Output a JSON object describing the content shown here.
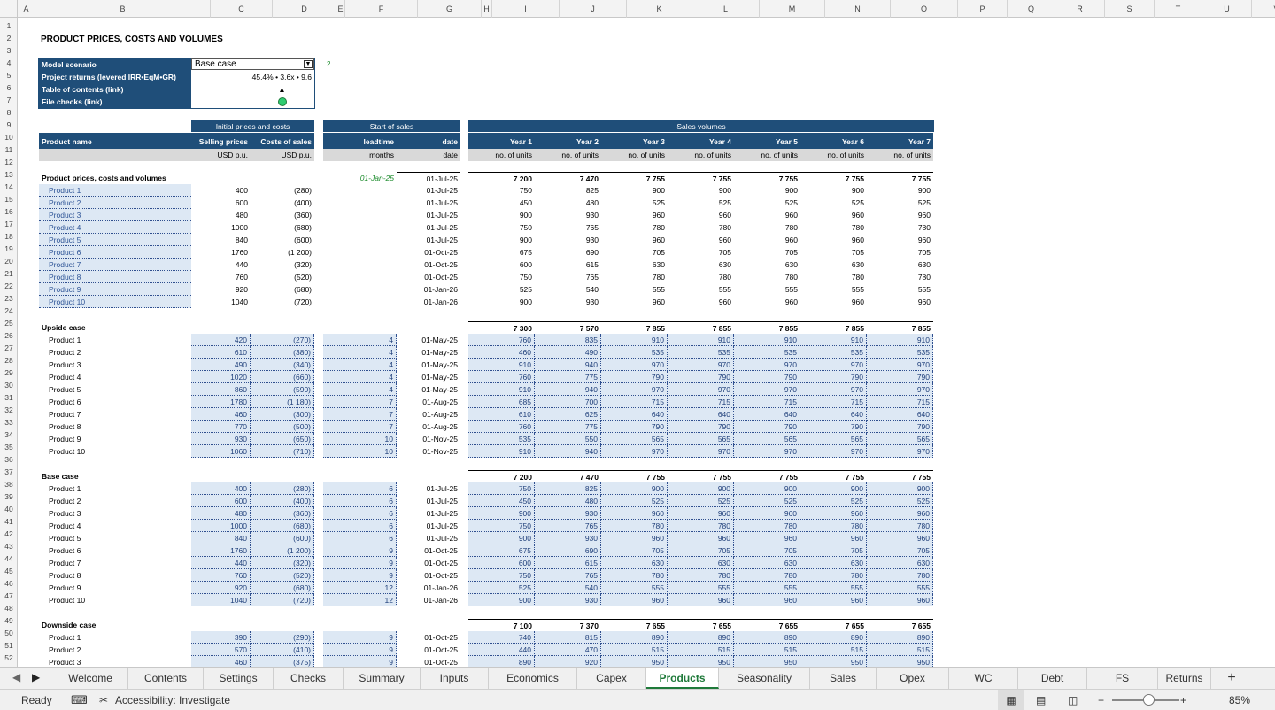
{
  "columns": [
    "A",
    "B",
    "C",
    "D",
    "E",
    "F",
    "G",
    "H",
    "I",
    "J",
    "K",
    "L",
    "M",
    "N",
    "O",
    "P",
    "Q",
    "R",
    "S",
    "T",
    "U",
    "V"
  ],
  "title": "PRODUCT PRICES, COSTS AND VOLUMES",
  "info": {
    "scenario_label": "Model scenario",
    "scenario_value": "Base case",
    "scenario_index": "2",
    "returns_label": "Project returns (levered IRR•EqM•GR)",
    "returns_value": "45.4% • 3.6x • 9.6",
    "toc_label": "Table of contents (link)",
    "toc_symbol": "▲",
    "checks_label": "File checks (link)"
  },
  "headers": {
    "group_prices": "Initial prices and costs",
    "group_start": "Start of sales",
    "group_volumes": "Sales volumes",
    "product_name": "Product name",
    "selling_prices": "Selling prices",
    "costs_of_sales": "Costs of sales",
    "leadtime": "leadtime",
    "date": "date",
    "years": [
      "Year 1",
      "Year 2",
      "Year 3",
      "Year 4",
      "Year 5",
      "Year 6",
      "Year 7"
    ],
    "unit_price": "USD p.u.",
    "unit_cost": "USD p.u.",
    "unit_months": "months",
    "unit_date": "date",
    "unit_units": "no. of units"
  },
  "sections": [
    {
      "title": "Product prices, costs and volumes",
      "startdate": "01-Jan-25",
      "totaldate": "01-Jul-25",
      "totals": [
        "7 200",
        "7 470",
        "7 755",
        "7 755",
        "7 755",
        "7 755",
        "7 755"
      ],
      "rows": [
        {
          "name": "Product 1",
          "price": "400",
          "cost": "(280)",
          "lead": "",
          "date": "01-Jul-25",
          "vols": [
            "750",
            "825",
            "900",
            "900",
            "900",
            "900",
            "900"
          ]
        },
        {
          "name": "Product 2",
          "price": "600",
          "cost": "(400)",
          "lead": "",
          "date": "01-Jul-25",
          "vols": [
            "450",
            "480",
            "525",
            "525",
            "525",
            "525",
            "525"
          ]
        },
        {
          "name": "Product 3",
          "price": "480",
          "cost": "(360)",
          "lead": "",
          "date": "01-Jul-25",
          "vols": [
            "900",
            "930",
            "960",
            "960",
            "960",
            "960",
            "960"
          ]
        },
        {
          "name": "Product 4",
          "price": "1000",
          "cost": "(680)",
          "lead": "",
          "date": "01-Jul-25",
          "vols": [
            "750",
            "765",
            "780",
            "780",
            "780",
            "780",
            "780"
          ]
        },
        {
          "name": "Product 5",
          "price": "840",
          "cost": "(600)",
          "lead": "",
          "date": "01-Jul-25",
          "vols": [
            "900",
            "930",
            "960",
            "960",
            "960",
            "960",
            "960"
          ]
        },
        {
          "name": "Product 6",
          "price": "1760",
          "cost": "(1 200)",
          "lead": "",
          "date": "01-Oct-25",
          "vols": [
            "675",
            "690",
            "705",
            "705",
            "705",
            "705",
            "705"
          ]
        },
        {
          "name": "Product 7",
          "price": "440",
          "cost": "(320)",
          "lead": "",
          "date": "01-Oct-25",
          "vols": [
            "600",
            "615",
            "630",
            "630",
            "630",
            "630",
            "630"
          ]
        },
        {
          "name": "Product 8",
          "price": "760",
          "cost": "(520)",
          "lead": "",
          "date": "01-Oct-25",
          "vols": [
            "750",
            "765",
            "780",
            "780",
            "780",
            "780",
            "780"
          ]
        },
        {
          "name": "Product 9",
          "price": "920",
          "cost": "(680)",
          "lead": "",
          "date": "01-Jan-26",
          "vols": [
            "525",
            "540",
            "555",
            "555",
            "555",
            "555",
            "555"
          ]
        },
        {
          "name": "Product 10",
          "price": "1040",
          "cost": "(720)",
          "lead": "",
          "date": "01-Jan-26",
          "vols": [
            "900",
            "930",
            "960",
            "960",
            "960",
            "960",
            "960"
          ]
        }
      ]
    },
    {
      "title": "Upside case",
      "startdate": "",
      "totaldate": "",
      "totals": [
        "7 300",
        "7 570",
        "7 855",
        "7 855",
        "7 855",
        "7 855",
        "7 855"
      ],
      "rows": [
        {
          "name": "Product 1",
          "price": "420",
          "cost": "(270)",
          "lead": "4",
          "date": "01-May-25",
          "vols": [
            "760",
            "835",
            "910",
            "910",
            "910",
            "910",
            "910"
          ]
        },
        {
          "name": "Product 2",
          "price": "610",
          "cost": "(380)",
          "lead": "4",
          "date": "01-May-25",
          "vols": [
            "460",
            "490",
            "535",
            "535",
            "535",
            "535",
            "535"
          ]
        },
        {
          "name": "Product 3",
          "price": "490",
          "cost": "(340)",
          "lead": "4",
          "date": "01-May-25",
          "vols": [
            "910",
            "940",
            "970",
            "970",
            "970",
            "970",
            "970"
          ]
        },
        {
          "name": "Product 4",
          "price": "1020",
          "cost": "(660)",
          "lead": "4",
          "date": "01-May-25",
          "vols": [
            "760",
            "775",
            "790",
            "790",
            "790",
            "790",
            "790"
          ]
        },
        {
          "name": "Product 5",
          "price": "860",
          "cost": "(590)",
          "lead": "4",
          "date": "01-May-25",
          "vols": [
            "910",
            "940",
            "970",
            "970",
            "970",
            "970",
            "970"
          ]
        },
        {
          "name": "Product 6",
          "price": "1780",
          "cost": "(1 180)",
          "lead": "7",
          "date": "01-Aug-25",
          "vols": [
            "685",
            "700",
            "715",
            "715",
            "715",
            "715",
            "715"
          ]
        },
        {
          "name": "Product 7",
          "price": "460",
          "cost": "(300)",
          "lead": "7",
          "date": "01-Aug-25",
          "vols": [
            "610",
            "625",
            "640",
            "640",
            "640",
            "640",
            "640"
          ]
        },
        {
          "name": "Product 8",
          "price": "770",
          "cost": "(500)",
          "lead": "7",
          "date": "01-Aug-25",
          "vols": [
            "760",
            "775",
            "790",
            "790",
            "790",
            "790",
            "790"
          ]
        },
        {
          "name": "Product 9",
          "price": "930",
          "cost": "(650)",
          "lead": "10",
          "date": "01-Nov-25",
          "vols": [
            "535",
            "550",
            "565",
            "565",
            "565",
            "565",
            "565"
          ]
        },
        {
          "name": "Product 10",
          "price": "1060",
          "cost": "(710)",
          "lead": "10",
          "date": "01-Nov-25",
          "vols": [
            "910",
            "940",
            "970",
            "970",
            "970",
            "970",
            "970"
          ]
        }
      ]
    },
    {
      "title": "Base case",
      "startdate": "",
      "totaldate": "",
      "totals": [
        "7 200",
        "7 470",
        "7 755",
        "7 755",
        "7 755",
        "7 755",
        "7 755"
      ],
      "rows": [
        {
          "name": "Product 1",
          "price": "400",
          "cost": "(280)",
          "lead": "6",
          "date": "01-Jul-25",
          "vols": [
            "750",
            "825",
            "900",
            "900",
            "900",
            "900",
            "900"
          ]
        },
        {
          "name": "Product 2",
          "price": "600",
          "cost": "(400)",
          "lead": "6",
          "date": "01-Jul-25",
          "vols": [
            "450",
            "480",
            "525",
            "525",
            "525",
            "525",
            "525"
          ]
        },
        {
          "name": "Product 3",
          "price": "480",
          "cost": "(360)",
          "lead": "6",
          "date": "01-Jul-25",
          "vols": [
            "900",
            "930",
            "960",
            "960",
            "960",
            "960",
            "960"
          ]
        },
        {
          "name": "Product 4",
          "price": "1000",
          "cost": "(680)",
          "lead": "6",
          "date": "01-Jul-25",
          "vols": [
            "750",
            "765",
            "780",
            "780",
            "780",
            "780",
            "780"
          ]
        },
        {
          "name": "Product 5",
          "price": "840",
          "cost": "(600)",
          "lead": "6",
          "date": "01-Jul-25",
          "vols": [
            "900",
            "930",
            "960",
            "960",
            "960",
            "960",
            "960"
          ]
        },
        {
          "name": "Product 6",
          "price": "1760",
          "cost": "(1 200)",
          "lead": "9",
          "date": "01-Oct-25",
          "vols": [
            "675",
            "690",
            "705",
            "705",
            "705",
            "705",
            "705"
          ]
        },
        {
          "name": "Product 7",
          "price": "440",
          "cost": "(320)",
          "lead": "9",
          "date": "01-Oct-25",
          "vols": [
            "600",
            "615",
            "630",
            "630",
            "630",
            "630",
            "630"
          ]
        },
        {
          "name": "Product 8",
          "price": "760",
          "cost": "(520)",
          "lead": "9",
          "date": "01-Oct-25",
          "vols": [
            "750",
            "765",
            "780",
            "780",
            "780",
            "780",
            "780"
          ]
        },
        {
          "name": "Product 9",
          "price": "920",
          "cost": "(680)",
          "lead": "12",
          "date": "01-Jan-26",
          "vols": [
            "525",
            "540",
            "555",
            "555",
            "555",
            "555",
            "555"
          ]
        },
        {
          "name": "Product 10",
          "price": "1040",
          "cost": "(720)",
          "lead": "12",
          "date": "01-Jan-26",
          "vols": [
            "900",
            "930",
            "960",
            "960",
            "960",
            "960",
            "960"
          ]
        }
      ]
    },
    {
      "title": "Downside case",
      "startdate": "",
      "totaldate": "",
      "totals": [
        "7 100",
        "7 370",
        "7 655",
        "7 655",
        "7 655",
        "7 655",
        "7 655"
      ],
      "rows": [
        {
          "name": "Product 1",
          "price": "390",
          "cost": "(290)",
          "lead": "9",
          "date": "01-Oct-25",
          "vols": [
            "740",
            "815",
            "890",
            "890",
            "890",
            "890",
            "890"
          ]
        },
        {
          "name": "Product 2",
          "price": "570",
          "cost": "(410)",
          "lead": "9",
          "date": "01-Oct-25",
          "vols": [
            "440",
            "470",
            "515",
            "515",
            "515",
            "515",
            "515"
          ]
        },
        {
          "name": "Product 3",
          "price": "460",
          "cost": "(375)",
          "lead": "9",
          "date": "01-Oct-25",
          "vols": [
            "890",
            "920",
            "950",
            "950",
            "950",
            "950",
            "950"
          ]
        }
      ]
    }
  ],
  "tabs": [
    "Welcome",
    "Contents",
    "Settings",
    "Checks",
    "Summary",
    "Inputs",
    "Economics",
    "Capex",
    "Products",
    "Seasonality",
    "Sales",
    "Opex",
    "WC",
    "Debt",
    "FS",
    "Returns"
  ],
  "active_tab": "Products",
  "status": {
    "ready": "Ready",
    "accessibility": "Accessibility: Investigate",
    "zoom": "85%"
  },
  "colors": {
    "header_blue": "#1f4e79",
    "input_blue": "#dde8f4",
    "active_tab_green": "#1f7a3a",
    "check_ok": "#2ecc71"
  }
}
